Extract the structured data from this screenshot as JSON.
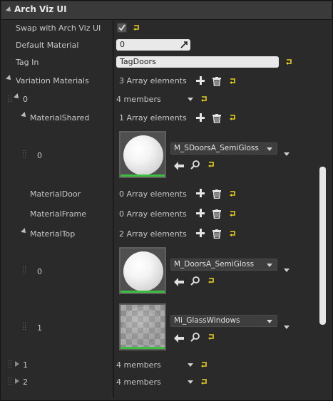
{
  "header": {
    "title": "Arch Viz UI"
  },
  "rows": {
    "swap": {
      "label": "Swap with Arch Viz UI",
      "checked": true
    },
    "default_material": {
      "label": "Default Material",
      "value": "0"
    },
    "tag_in": {
      "label": "Tag In",
      "value": "TagDoors"
    },
    "variation_materials": {
      "label": "Variation Materials",
      "value": "3 Array elements"
    },
    "item0": {
      "label": "0",
      "value": "4 members"
    },
    "material_shared": {
      "label": "MaterialShared",
      "value": "1 Array elements"
    },
    "material_shared_0": {
      "label": "0",
      "asset": "M_SDoorsA_SemiGloss"
    },
    "material_door": {
      "label": "MaterialDoor",
      "value": "0 Array elements"
    },
    "material_frame": {
      "label": "MaterialFrame",
      "value": "0 Array elements"
    },
    "material_top": {
      "label": "MaterialTop",
      "value": "2 Array elements"
    },
    "material_top_0": {
      "label": "0",
      "asset": "M_DoorsA_SemiGloss"
    },
    "material_top_1": {
      "label": "1",
      "asset": "Mi_GlassWindows"
    },
    "item1": {
      "label": "1",
      "value": "4 members"
    },
    "item2": {
      "label": "2",
      "value": "4 members"
    }
  },
  "icons": {
    "reset": "reset-to-default-icon",
    "add": "add-element-icon",
    "trash": "trash-icon",
    "use": "use-selected-asset-icon",
    "browse": "browse-asset-icon"
  },
  "colors": {
    "reset_yellow": "#e8d020",
    "thumb_bar_green": "#3fbf3f",
    "field_bg": "#e9e9e9",
    "panel_bg": "#2a2a2a"
  }
}
